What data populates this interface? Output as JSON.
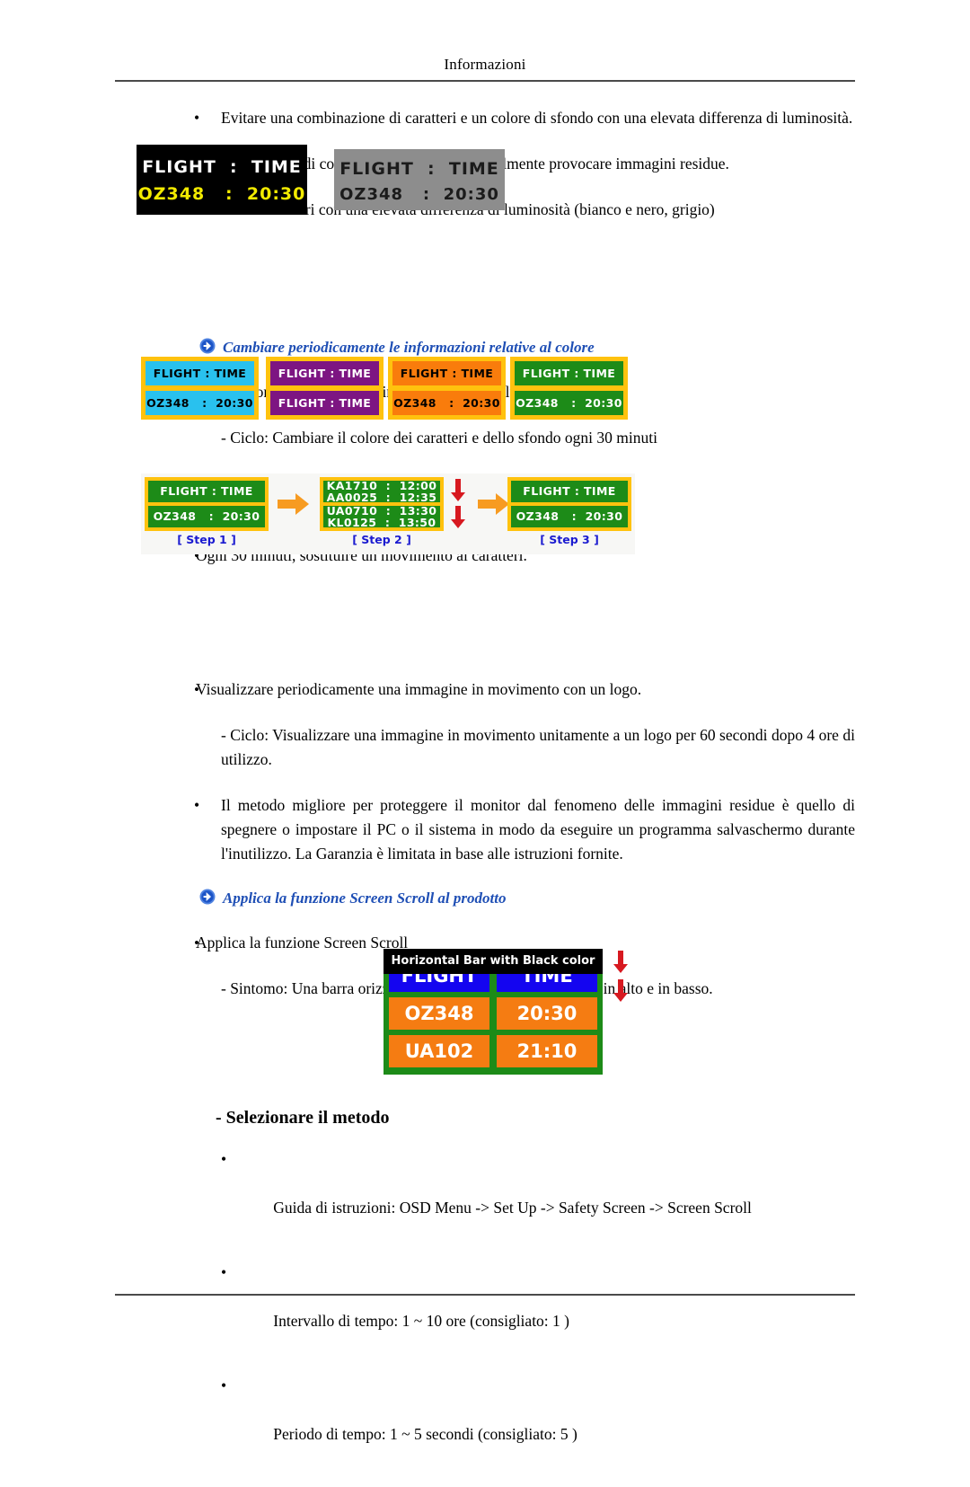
{
  "header": {
    "title": "Informazioni"
  },
  "icons": {
    "section_arrow": "blue-circle-arrow-icon",
    "step_arrow": "orange-right-arrow-icon",
    "scroll_arrow": "red-down-arrow-icon",
    "bullet": "•"
  },
  "colors": {
    "heading_blue": "#1f4fb5",
    "step_label_blue": "#1a1ad0",
    "gold": "#ffc20e",
    "green": "#1d8b18",
    "orange": "#f57c12",
    "blue_cell": "#1405f0",
    "cyan": "#29c1ee",
    "purple": "#7d1582",
    "panel_orange": "#f97c0c",
    "yellow_text": "#f2ea00",
    "grey_board": "#8d8d8d",
    "arrow_orange": "#f79b21",
    "arrow_red": "#d71920"
  },
  "body": {
    "b1": "Evitare una combinazione di caratteri e un colore di sfondo con una elevata differenza di luminosità.",
    "p1": "Evitare l'uso di colori grigi, che possono facilmente provocare immagini residue.",
    "p2": "Evitare: Colori con una elevata differenza di luminosità (bianco e nero, grigio)",
    "head1": "Cambiare periodicamente le informazioni relative al colore",
    "b2": "Usare colori chiari con una minima differenza di luminosità",
    "p3": "- Ciclo: Cambiare il colore dei caratteri e dello sfondo ogni 30 minuti",
    "b3": "Ogni 30 minuti, sostituire un movimento ai caratteri.",
    "b4": "Visualizzare periodicamente una immagine in movimento con un logo.",
    "p4": "- Ciclo: Visualizzare una immagine in movimento unitamente a un logo per 60 secondi dopo 4 ore di utilizzo.",
    "b5": "Il metodo migliore per proteggere il monitor dal fenomeno delle immagini residue è quello di spegnere o impostare il PC o il sistema in modo da eseguire un programma salvaschermo durante l'inutilizzo. La Garanzia è limitata in base alle istruzioni fornite.",
    "head2": "Applica la funzione Screen Scroll al prodotto",
    "b6": "Applica la funzione Screen Scroll",
    "p5": "- Sintomo: Una barra orizzontale di colore nero che scorrere in alto e in basso."
  },
  "figure1": {
    "black_board": {
      "line1": "FLIGHT  :  TIME",
      "line2": "OZ348   :  20:30"
    },
    "grey_board": {
      "line1": "FLIGHT  :  TIME",
      "line2": "OZ348   :  20:30"
    }
  },
  "figure2": {
    "boards": [
      {
        "bg": "#29c1ee",
        "fg": "#000000",
        "line1": "FLIGHT : TIME",
        "line2": "OZ348   :  20:30"
      },
      {
        "bg": "#7d1582",
        "fg": "#ffffff",
        "line1": "FLIGHT : TIME",
        "line2": "FLIGHT : TIME"
      },
      {
        "bg": "#f97c0c",
        "fg": "#000000",
        "line1": "FLIGHT : TIME",
        "line2": "OZ348   :  20:30"
      },
      {
        "bg": "#1d8b18",
        "fg": "#ffffff",
        "line1": "FLIGHT : TIME",
        "line2": "OZ348   :  20:30"
      }
    ]
  },
  "figure3": {
    "steps": [
      {
        "label": "[ Step 1 ]",
        "line1": "FLIGHT : TIME",
        "line2": "OZ348   :  20:30"
      },
      {
        "label": "[ Step 2 ]",
        "scroll1_top": "KA1710  :  12:00",
        "scroll1_bottom": "AA0025  :  12:35",
        "scroll2_top": "UA0710  :  13:30",
        "scroll2_bottom": "KL0125  :  13:50"
      },
      {
        "label": "[ Step 3 ]",
        "line1": "FLIGHT : TIME",
        "line2": "OZ348   :  20:30"
      }
    ]
  },
  "figure4": {
    "bar_label": "Horizontal Bar with Black color",
    "rows": [
      [
        "FLIGHT",
        "TIME"
      ],
      [
        "OZ348",
        "20:30"
      ],
      [
        "UA102",
        "21:10"
      ]
    ]
  },
  "bottom": {
    "title": "- Selezionare il metodo",
    "items": [
      "Guida di istruzioni: OSD Menu -> Set Up -> Safety Screen -> Screen Scroll",
      "Intervallo di tempo: 1 ~ 10 ore (consigliato: 1 )",
      "Periodo di tempo: 1 ~ 5 secondi (consigliato: 5 )"
    ]
  }
}
